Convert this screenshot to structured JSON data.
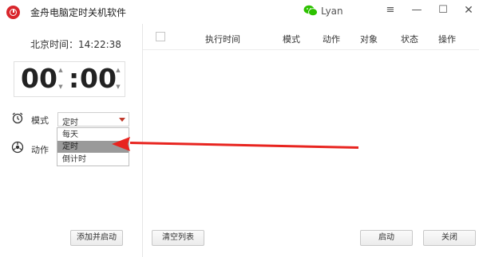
{
  "window": {
    "title": "金舟电脑定时关机软件",
    "user_name": "Lyan",
    "controls": [
      "≡",
      "—",
      "☐",
      "✕"
    ]
  },
  "left": {
    "beijing_time": "北京时间：14:22:38",
    "hours": "00",
    "colon": ":",
    "minutes": "00",
    "mode_label": "模式",
    "mode_value": "定时",
    "action_label": "动作",
    "mode_options": [
      "每天",
      "定时",
      "倒计时"
    ],
    "selected_option_index": 1,
    "add_button": "添加并启动"
  },
  "table": {
    "headers": [
      "执行时间",
      "模式",
      "动作",
      "对象",
      "状态",
      "操作"
    ],
    "rows": []
  },
  "bottom": {
    "clear_button": "清空列表",
    "start_button": "启动",
    "close_button": "关闭"
  },
  "colors": {
    "accent": "#d9262c",
    "wechat": "#2dc100",
    "arrow": "#e8241f",
    "selected_option_bg": "#9a9a9a"
  },
  "icons": {
    "app": "app-logo-icon",
    "wechat": "wechat-icon",
    "alarm": "alarm-clock-icon",
    "action": "power-action-icon"
  }
}
